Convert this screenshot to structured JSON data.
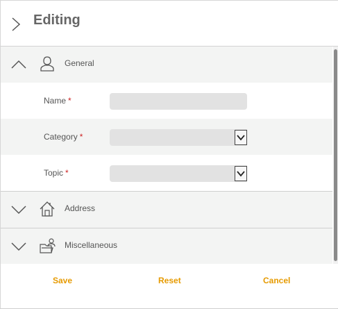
{
  "header": {
    "title": "Editing",
    "expand_icon": "chevron-right-icon"
  },
  "sections": {
    "general": {
      "label": "General",
      "icon": "user-icon",
      "toggle_icon": "chevron-up-icon"
    },
    "address": {
      "label": "Address",
      "icon": "home-icon",
      "toggle_icon": "chevron-down-icon"
    },
    "misc": {
      "label": "Miscellaneous",
      "icon": "folder-user-icon",
      "toggle_icon": "chevron-down-icon"
    }
  },
  "fields": {
    "name": {
      "label": "Name",
      "required_mark": "*",
      "value": ""
    },
    "category": {
      "label": "Category",
      "required_mark": "*",
      "value": ""
    },
    "topic": {
      "label": "Topic",
      "required_mark": "*",
      "value": ""
    }
  },
  "footer": {
    "save": "Save",
    "reset": "Reset",
    "cancel": "Cancel"
  },
  "colors": {
    "accent": "#e69a00",
    "required": "#cc2222",
    "row_alt": "#f3f4f3",
    "input_bg": "#e2e2e2"
  }
}
